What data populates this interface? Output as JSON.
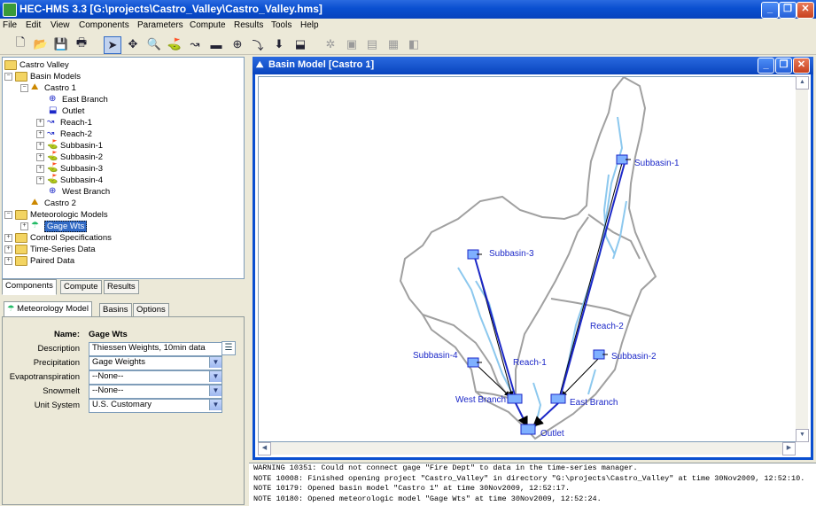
{
  "window": {
    "title": "HEC-HMS 3.3 [G:\\projects\\Castro_Valley\\Castro_Valley.hms]"
  },
  "menu": [
    "File",
    "Edit",
    "View",
    "Components",
    "Parameters",
    "Compute",
    "Results",
    "Tools",
    "Help"
  ],
  "toolbar_icons": [
    "new-file-icon",
    "open-folder-icon",
    "save-icon",
    "print-icon",
    "arrow-pointer-icon",
    "move-icon",
    "zoom-icon",
    "subbasin-tool-icon",
    "reach-tool-icon",
    "reservoir-tool-icon",
    "junction-tool-icon",
    "diversion-tool-icon",
    "source-tool-icon",
    "sink-tool-icon",
    "compute-icon",
    "results-graph-icon",
    "results-summary-icon",
    "results-table-icon",
    "results-global-icon"
  ],
  "tree": {
    "root": "Castro Valley",
    "basin_models_label": "Basin Models",
    "castro1": "Castro 1",
    "castro1_children": [
      "East Branch",
      "Outlet",
      "Reach-1",
      "Reach-2",
      "Subbasin-1",
      "Subbasin-2",
      "Subbasin-3",
      "Subbasin-4",
      "West Branch"
    ],
    "castro2": "Castro 2",
    "met_models_label": "Meteorologic Models",
    "gage_wts": "Gage Wts",
    "control_specs": "Control Specifications",
    "time_series": "Time-Series Data",
    "paired_data": "Paired Data"
  },
  "tree_tabs": [
    "Components",
    "Compute",
    "Results"
  ],
  "prop_tabs": [
    "Meteorology Model",
    "Basins",
    "Options"
  ],
  "props": {
    "name_label": "Name:",
    "name_value": "Gage Wts",
    "description_label": "Description",
    "description_value": "Thiessen Weights, 10min data",
    "precipitation_label": "Precipitation",
    "precipitation_value": "Gage Weights",
    "evapo_label": "Evapotranspiration",
    "evapo_value": "--None--",
    "snowmelt_label": "Snowmelt",
    "snowmelt_value": "--None--",
    "unit_label": "Unit System",
    "unit_value": "U.S. Customary"
  },
  "basin_window": {
    "title": "Basin Model [Castro 1]"
  },
  "basin_labels": {
    "subbasin1": "Subbasin-1",
    "subbasin2": "Subbasin-2",
    "subbasin3": "Subbasin-3",
    "subbasin4": "Subbasin-4",
    "reach1": "Reach-1",
    "reach2": "Reach-2",
    "west_branch": "West Branch",
    "east_branch": "East Branch",
    "outlet": "Outlet"
  },
  "messages": [
    "WARNING 10351: Could not connect gage \"Fire Dept\" to data in the time-series manager.",
    "NOTE 10008: Finished opening project \"Castro_Valley\" in directory \"G:\\projects\\Castro_Valley\" at time 30Nov2009, 12:52:10.",
    "NOTE 10179: Opened basin model \"Castro 1\" at time 30Nov2009, 12:52:17.",
    "NOTE 10180: Opened meteorologic model \"Gage Wts\" at time 30Nov2009, 12:52:24."
  ],
  "colors": {
    "title_blue": "#0a4fd0",
    "selection": "#316ac5",
    "basin_outline": "#a0a0a0",
    "stream": "#8cc8ee",
    "reach": "#1c28c8"
  }
}
